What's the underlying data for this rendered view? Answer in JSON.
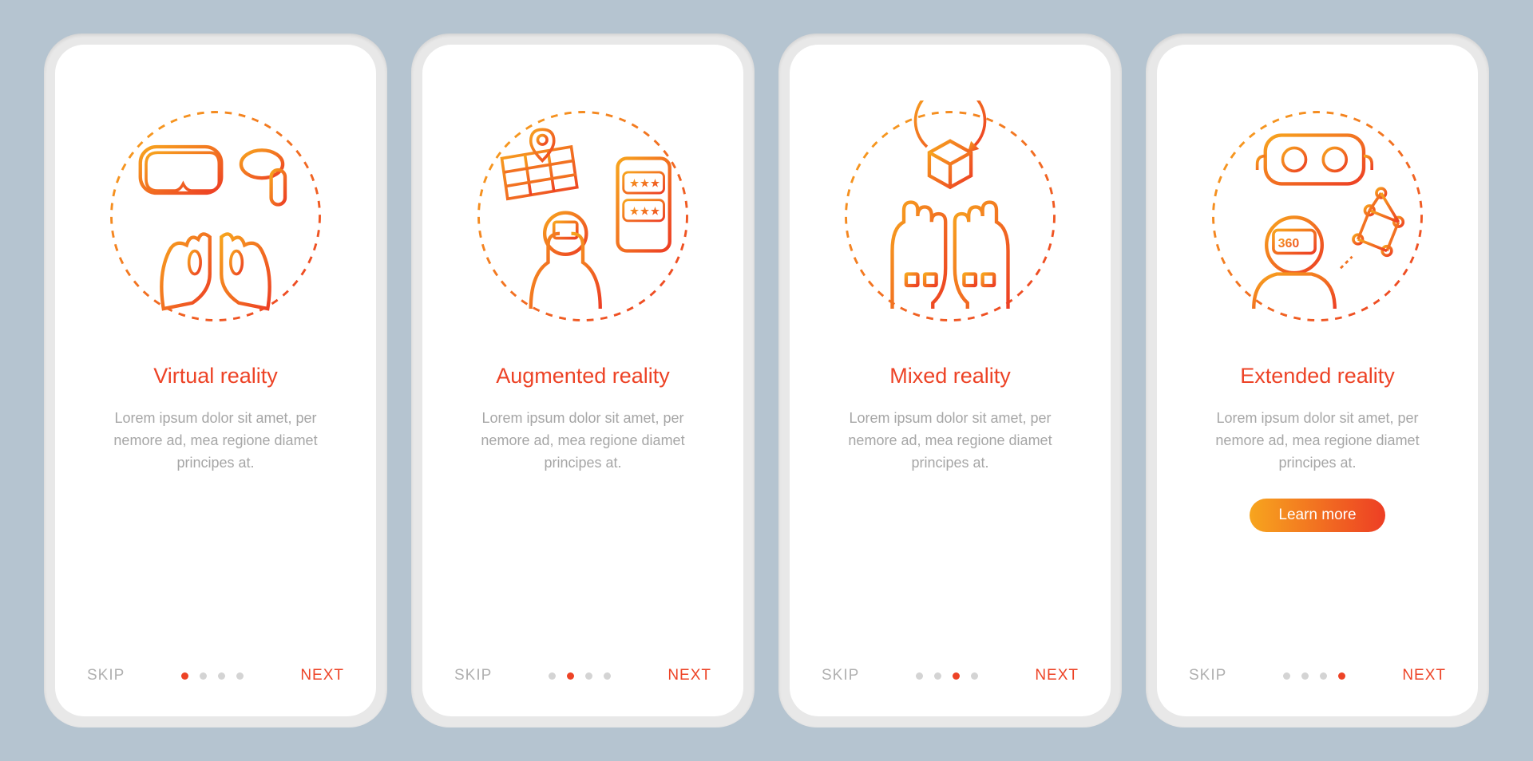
{
  "common": {
    "skip": "SKIP",
    "next": "NEXT",
    "desc": "Lorem ipsum dolor sit amet, per nemore ad, mea regione diamet principes at.",
    "learn_more": "Learn more"
  },
  "screens": [
    {
      "title": "Virtual reality",
      "icon": "vr-headset-hands-icon",
      "active_dot": 0,
      "has_cta": false
    },
    {
      "title": "Augmented reality",
      "icon": "ar-phone-map-icon",
      "active_dot": 1,
      "has_cta": false
    },
    {
      "title": "Mixed reality",
      "icon": "mr-gloves-cube-icon",
      "active_dot": 2,
      "has_cta": false
    },
    {
      "title": "Extended reality",
      "icon": "xr-person-network-icon",
      "active_dot": 3,
      "has_cta": true
    }
  ],
  "dot_count": 4
}
